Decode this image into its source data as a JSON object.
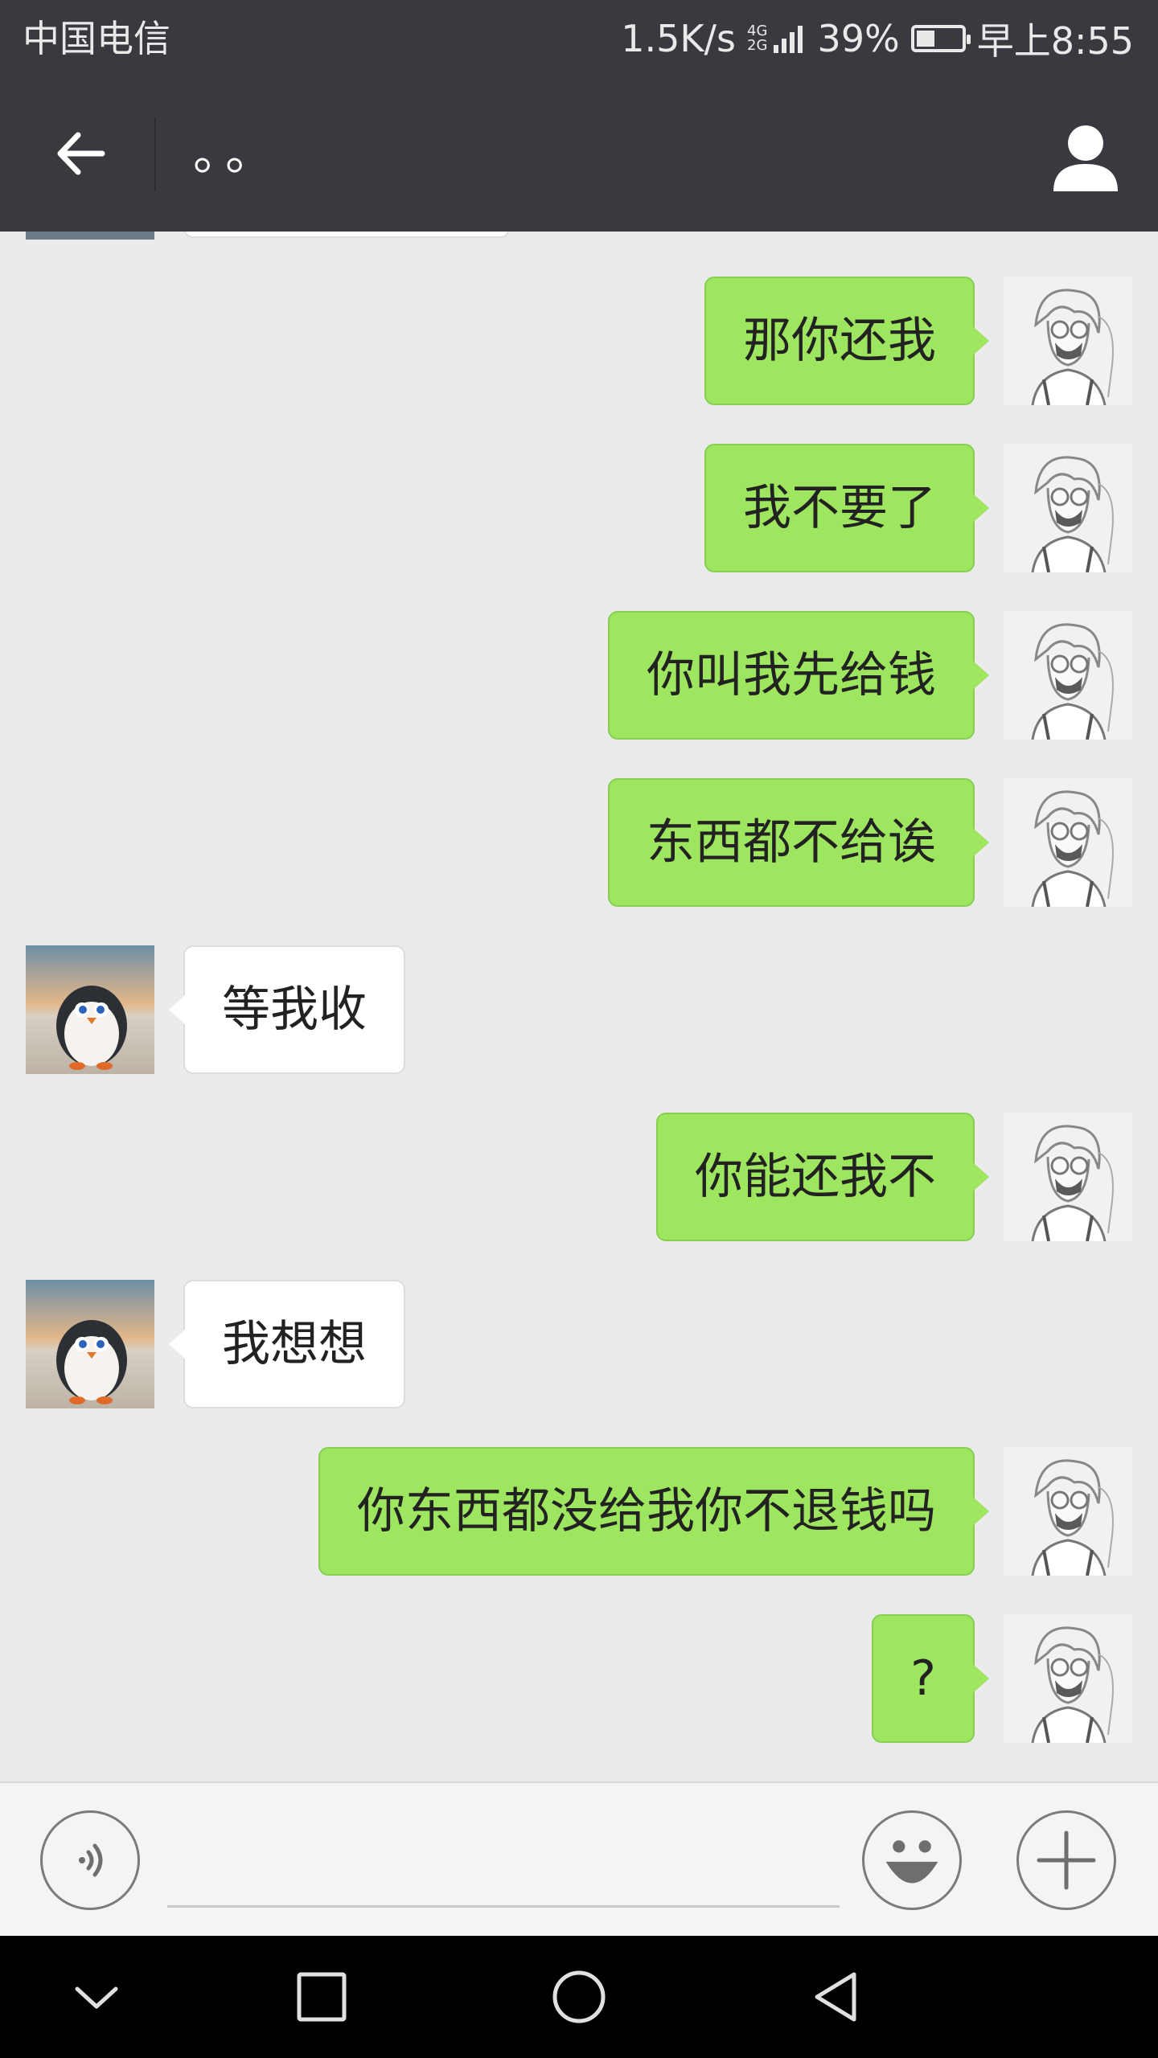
{
  "status_bar": {
    "carrier": "中国电信",
    "speed": "1.5K/s",
    "network_tag_top": "4G",
    "network_tag_bottom": "2G",
    "battery": "39%",
    "battery_level": 0.39,
    "time": "早上8:55"
  },
  "nav": {
    "title": "。。",
    "back_icon": "back-arrow-icon",
    "profile_icon": "person-icon"
  },
  "messages": [
    {
      "from": "me",
      "text": "那你还我"
    },
    {
      "from": "me",
      "text": "我不要了"
    },
    {
      "from": "me",
      "text": "你叫我先给钱"
    },
    {
      "from": "me",
      "text": "东西都不给诶"
    },
    {
      "from": "other",
      "text": "等我收"
    },
    {
      "from": "me",
      "text": "你能还我不"
    },
    {
      "from": "other",
      "text": "我想想"
    },
    {
      "from": "me",
      "text": "你东西都没给我你不退钱吗"
    },
    {
      "from": "me",
      "text": "?"
    }
  ],
  "input_bar": {
    "voice_icon": "voice-icon",
    "emoji_icon": "emoji-icon",
    "plus_icon": "plus-icon",
    "placeholder": ""
  },
  "system_nav": {
    "buttons": [
      "chevron-down-icon",
      "square-icon",
      "circle-icon",
      "triangle-back-icon"
    ]
  },
  "colors": {
    "header_bg": "#393a3f",
    "chat_bg": "#ebebeb",
    "my_bubble": "#9ee65f",
    "their_bubble": "#ffffff"
  }
}
